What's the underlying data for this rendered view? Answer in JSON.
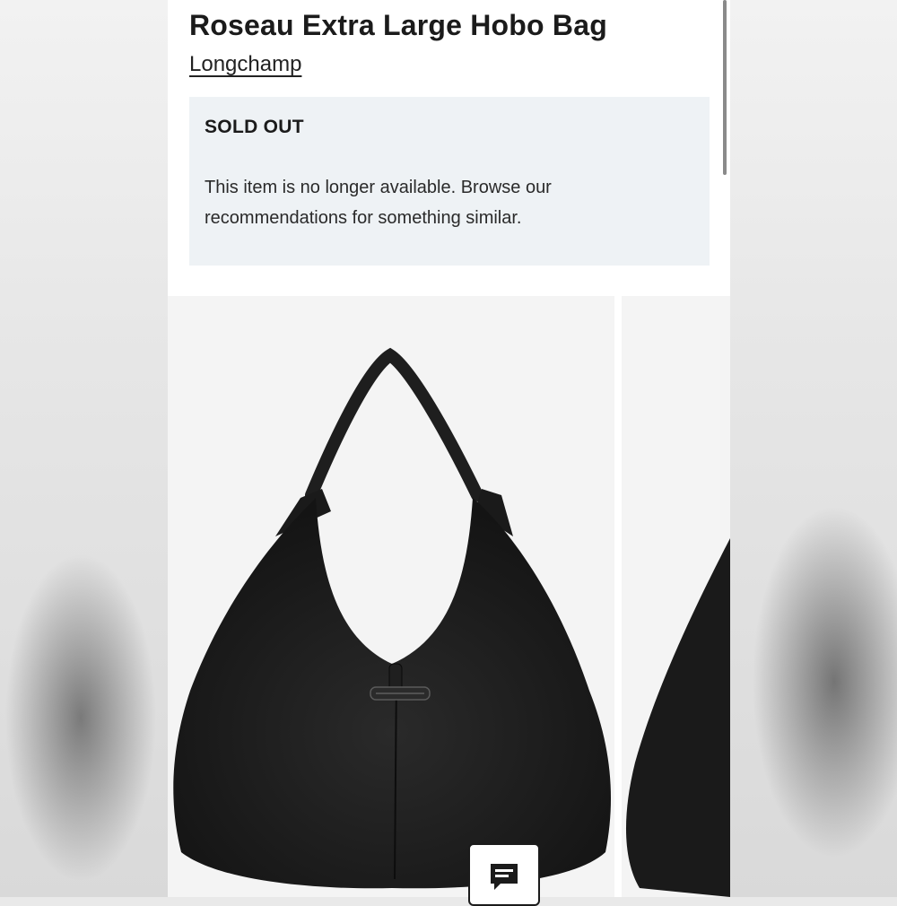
{
  "product": {
    "title": "Roseau Extra Large Hobo Bag",
    "brand": "Longchamp"
  },
  "availability": {
    "heading": "SOLD OUT",
    "message": "This item is no longer available. Browse our recommendations for something similar."
  },
  "gallery": {
    "images": [
      {
        "subject": "black leather hobo bag, front view"
      },
      {
        "subject": "black leather hobo bag, partial view"
      }
    ]
  },
  "chat": {
    "icon": "chat-bubble-icon"
  },
  "colors": {
    "notice_background": "#eef2f5",
    "text": "#1b1b1b",
    "bag": "#1c1c1c"
  }
}
